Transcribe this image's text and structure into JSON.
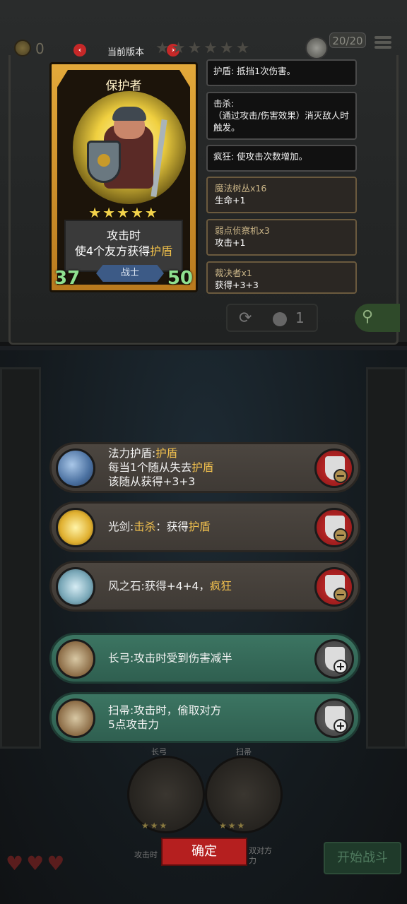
{
  "hud": {
    "coins": "0",
    "version_label": "当前版本",
    "version_prev": "‹",
    "version_next": "›",
    "stars": "★★★★★★",
    "count": "20/20"
  },
  "card": {
    "name": "保护者",
    "stars": "★★★★★",
    "text_line1": "攻击时",
    "text_line2_pre": "使4个友方获得",
    "text_line2_kw": "护盾",
    "attack": "37",
    "health": "50",
    "class": "战士"
  },
  "keywords": [
    {
      "text": "护盾: 抵挡1次伤害。"
    },
    {
      "text": "击杀:\n（通过攻击/伤害效果）消灭敌人时触发。"
    },
    {
      "text": "疯狂: 使攻击次数增加。"
    }
  ],
  "items": [
    {
      "title": "魔法树丛x16",
      "stat": "生命+1"
    },
    {
      "title": "弱点侦察机x3",
      "stat": "攻击+1"
    },
    {
      "title": "裁决者x1",
      "stat": "获得+3+3"
    }
  ],
  "reroll": {
    "icon": "⟳",
    "cost": "1"
  },
  "search": {
    "icon": "⚲"
  },
  "rows": [
    {
      "status": "equipped",
      "lines": [
        [
          "法力护盾:",
          "",
          "护盾"
        ],
        [
          "每当1个随从失去",
          "",
          "护盾"
        ],
        [
          "该随从获得+3+3",
          "",
          ""
        ]
      ],
      "btn": "−"
    },
    {
      "status": "equipped",
      "lines": [
        [
          "光剑:",
          "击杀",
          "：获得",
          "护盾"
        ]
      ],
      "btn": "−"
    },
    {
      "status": "equipped",
      "lines": [
        [
          "风之石:获得+4+4，",
          "疯狂"
        ]
      ],
      "btn": "−"
    },
    {
      "status": "available",
      "lines": [
        [
          "长弓:攻击时受到伤害减半"
        ]
      ],
      "btn": "+"
    },
    {
      "status": "available",
      "lines": [
        [
          "扫帚:攻击时，偷取对方"
        ],
        [
          "5点攻击力"
        ]
      ],
      "btn": "+"
    }
  ],
  "row_text": {
    "r1l1a": "法力护盾:",
    "r1l1b": "护盾",
    "r1l2a": "每当1个随从失去",
    "r1l2b": "护盾",
    "r1l3": "该随从获得+3+3",
    "r2a": "光剑:",
    "r2b": "击杀",
    "r2c": "：获得",
    "r2d": "护盾",
    "r3a": "风之石:获得+4+4，",
    "r3b": "疯狂",
    "r4": "长弓:攻击时受到伤害减半",
    "r5l1": "扫帚:攻击时，偷取对方",
    "r5l2": "5点攻击力"
  },
  "buttons": {
    "minus": "−",
    "plus": "+"
  },
  "tray": {
    "slot_stars": "★★★",
    "left_label": "攻击时",
    "right_label": "双对方",
    "right_label2": "力",
    "top_left": "长弓",
    "top_right": "扫帚"
  },
  "hearts": "♥♥♥",
  "confirm_label": "确定",
  "start_label": "开始战斗"
}
